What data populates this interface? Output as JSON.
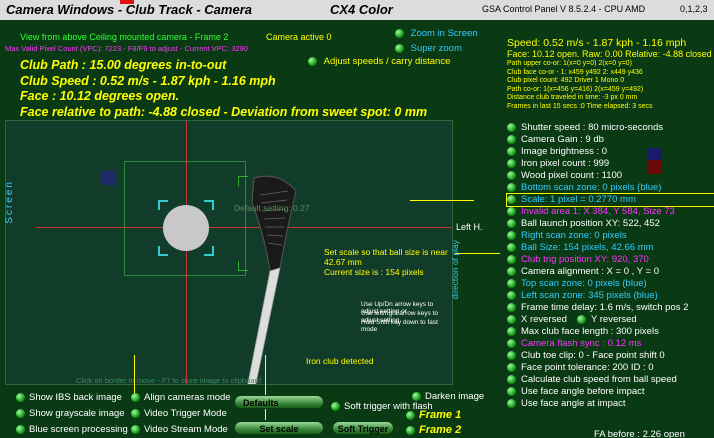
{
  "titlebar": {
    "title": "Camera Windows - Club Track - Camera",
    "product": "CX4 Color",
    "panel": "GSA Control Panel V 8.5.2.4 - CPU AMD",
    "version": "0,1,2,3"
  },
  "header": {
    "view_line": "View from above Ceiling mounted camera - Frame 2",
    "pixel_line": "Max Valid Pixel Count (VPC): 7223 - F8/F9 to adjust - Current VPC: 3290",
    "camera_active": "Camera active 0",
    "zoom_in_screen": "Zoom in Screen",
    "super_zoom": "Super zoom",
    "adjust_speeds": "Adjust speeds / carry distance"
  },
  "results": {
    "club_path": "Club Path : 15.00 degrees in-to-out",
    "club_speed": "Club Speed : 0.52 m/s - 1.87 kph - 1.16 mph",
    "face": "Face : 10.12 degrees open.",
    "face_relative": "Face relative to path: -4.88 closed - Deviation from sweet spot: 0 mm"
  },
  "camera_view": {
    "screen_label": "Screen",
    "default_setting": "Default setting: 0.27",
    "left_h": "Left H.",
    "set_scale_msg": "Set scale so that ball size is near 42.67 mm",
    "current_size": "Current size is : 154 pixels",
    "help1": "Use Up/Dn arrow keys to adjust setting or",
    "help2": "Use left/right arrow keys to adjust setting",
    "help3": "Hold Shift key down to fast mode",
    "iron_detected": "Iron club detected",
    "bottom_hint": "Click on border to move - F7 to store image to clipboard",
    "direction_label": "direction of play",
    "ball_size_px": 154,
    "ball_diameter_mm": 42.67
  },
  "right_panel": {
    "speed": "Speed: 0.52 m/s - 1.87 kph - 1.16 mph",
    "face": "Face: 10.12 open. Raw: 0.00 Relative: -4.88 closed",
    "tiny": [
      "Path upper co-or: 1(x=0 y=0) 2(x=0 y=0)",
      "Club face co-or - 1: x459 y492 2: x449 y436",
      "Club pixel count: 492 Driver 1 Mono 0",
      "Path co-or: 1(x=456 y=416) 2(x=459 y=492)",
      "Distance club traveled in time: -3 px 0 mm",
      "Frames in last 15 secs :0 Time elapsed: 3 secs"
    ],
    "items": [
      {
        "label": "Shutter speed : 80 micro-seconds",
        "color": "#ffffff",
        "led": true
      },
      {
        "label": "Camera Gain : 9 db",
        "color": "#ffffff",
        "led": true
      },
      {
        "label": "Image brightness : 0",
        "color": "#ffffff",
        "led": true
      },
      {
        "label": "Iron pixel count : 999",
        "color": "#ffffff",
        "led": true
      },
      {
        "label": "Wood pixel count : 1100",
        "color": "#ffffff",
        "led": true
      },
      {
        "label": "Bottom scan zone: 0 pixels (blue)",
        "color": "#33ccff",
        "led": true
      },
      {
        "label": "Scale: 1 pixel = 0.2770 mm",
        "color": "#33ccff",
        "led": true,
        "selected": true
      },
      {
        "label": "Invalid area 1: X 384, Y 584, Size 73",
        "color": "#ff33ff",
        "led": true
      },
      {
        "label": "Ball launch position XY: 522, 452",
        "color": "#ffffff",
        "led": true
      },
      {
        "label": "Right scan zone: 0 pixels",
        "color": "#33ccff",
        "led": true
      },
      {
        "label": "Ball Size: 154 pixels, 42.66 mm",
        "color": "#33ccff",
        "led": true
      },
      {
        "label": "Club trig position XY: 920, 370",
        "color": "#ff33ff",
        "led": true
      },
      {
        "label": "Camera alignment : X = 0 , Y = 0",
        "color": "#ffffff",
        "led": true
      },
      {
        "label": "Top scan zone: 0 pixels (blue)",
        "color": "#33ccff",
        "led": true
      },
      {
        "label": "Left scan zone: 345 pixels (blue)",
        "color": "#33ccff",
        "led": true
      },
      {
        "label": "Frame time delay: 1.6 m/s, switch pos 2",
        "color": "#ffffff",
        "led": true
      },
      {
        "label": "X reversed",
        "color": "#ffffff",
        "led": true,
        "extra": "Y reversed"
      },
      {
        "label": "Max club face length : 300 pixels",
        "color": "#ffffff",
        "led": true
      },
      {
        "label": "Camera flash sync : 0.12 ms",
        "color": "#ff33ff",
        "led": true
      },
      {
        "label": "Club toe clip: 0 - Face point shift 0",
        "color": "#ffffff",
        "led": true
      },
      {
        "label": "Face point tolerance: 200 ID : 0",
        "color": "#ffffff",
        "led": true
      },
      {
        "label": "Calculate club speed from ball speed",
        "color": "#ffffff",
        "led": true
      },
      {
        "label": "Use face angle before impact",
        "color": "#ffffff",
        "led": true
      },
      {
        "label": "Use face angle at impact",
        "color": "#ffffff",
        "led": true
      }
    ],
    "fa_before": "FA before : 2.26 open"
  },
  "bottom": {
    "show_ibs": "Show IBS back image",
    "show_gray": "Show grayscale image",
    "blue_screen": "Blue screen processing",
    "align_cameras": "Align cameras mode",
    "video_trigger": "Video Trigger Mode",
    "video_stream": "Video Stream Mode",
    "defaults_btn": "Defaults",
    "set_scale_btn": "Set scale",
    "soft_trigger_btn": "Soft Trigger",
    "soft_trigger_flash": "Soft trigger with flash",
    "darken_image": "Darken image",
    "frame1": "Frame 1",
    "frame2": "Frame 2"
  }
}
